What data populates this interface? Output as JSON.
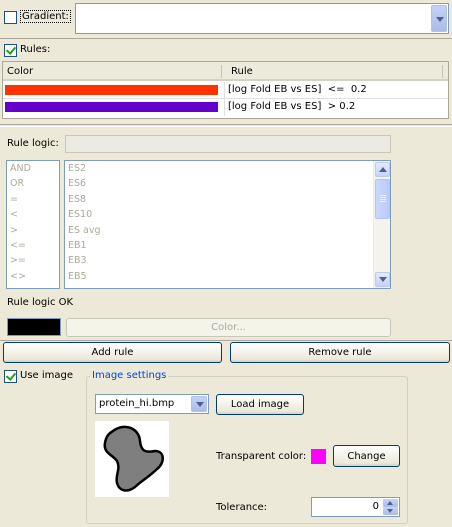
{
  "gradient": {
    "label": "Gradient:",
    "checked": false,
    "dropdown_value": ""
  },
  "rules_section": {
    "label": "Rules:",
    "checked": true,
    "columns": [
      "Color",
      "Rule"
    ],
    "rows": [
      {
        "color": "#ff3300",
        "rule": "[log Fold EB vs ES]  <=  0.2"
      },
      {
        "color": "#6600cc",
        "rule": "[log Fold EB vs ES]  > 0.2"
      }
    ]
  },
  "rule_logic": {
    "label": "Rule logic:",
    "value": "",
    "operators": [
      "AND",
      "OR",
      "=",
      "<",
      ">",
      "<=",
      ">=",
      "<>"
    ],
    "variables": [
      "ES2",
      "ES6",
      "ES8",
      "ES10",
      "ES avg",
      "EB1",
      "EB3",
      "EB5"
    ],
    "status": "Rule logic OK",
    "swatch_color": "#000000",
    "color_button": "Color..."
  },
  "actions": {
    "add_rule": "Add rule",
    "remove_rule": "Remove rule"
  },
  "use_image": {
    "label": "Use image",
    "checked": true
  },
  "image_settings": {
    "legend": "Image settings",
    "file": "protein_hi.bmp",
    "load_button": "Load image",
    "transparent_label": "Transparent color:",
    "transparent_color": "#ff00ff",
    "change_button": "Change",
    "tolerance_label": "Tolerance:",
    "tolerance_value": "0"
  },
  "icons": [
    "check-icon",
    "chevron-down-icon",
    "chevron-up-icon",
    "protein-image"
  ]
}
